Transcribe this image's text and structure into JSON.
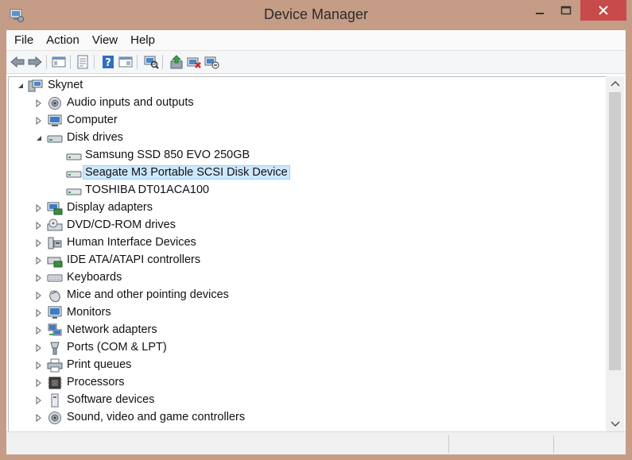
{
  "window": {
    "title": "Device Manager"
  },
  "menu": {
    "items": [
      "File",
      "Action",
      "View",
      "Help"
    ]
  },
  "toolbar": {
    "buttons": [
      "back-arrow-icon",
      "forward-arrow-icon",
      "show-hide-tree-icon",
      "properties-icon",
      "help-icon",
      "view-icon",
      "scan-hardware-icon",
      "update-driver-icon",
      "uninstall-icon",
      "disable-icon"
    ]
  },
  "tree": {
    "root": "Skynet",
    "categories": [
      {
        "label": "Audio inputs and outputs",
        "icon": "speaker-icon",
        "expanded": false
      },
      {
        "label": "Computer",
        "icon": "computer-icon",
        "expanded": false
      },
      {
        "label": "Disk drives",
        "icon": "disk-drive-icon",
        "expanded": true,
        "children": [
          "Samsung SSD 850 EVO 250GB",
          "Seagate M3 Portable SCSI Disk Device",
          "TOSHIBA DT01ACA100"
        ]
      },
      {
        "label": "Display adapters",
        "icon": "display-adapter-icon",
        "expanded": false
      },
      {
        "label": "DVD/CD-ROM drives",
        "icon": "dvd-drive-icon",
        "expanded": false
      },
      {
        "label": "Human Interface Devices",
        "icon": "hid-icon",
        "expanded": false
      },
      {
        "label": "IDE ATA/ATAPI controllers",
        "icon": "ide-controller-icon",
        "expanded": false
      },
      {
        "label": "Keyboards",
        "icon": "keyboard-icon",
        "expanded": false
      },
      {
        "label": "Mice and other pointing devices",
        "icon": "mouse-icon",
        "expanded": false
      },
      {
        "label": "Monitors",
        "icon": "monitor-icon",
        "expanded": false
      },
      {
        "label": "Network adapters",
        "icon": "network-adapter-icon",
        "expanded": false
      },
      {
        "label": "Ports (COM & LPT)",
        "icon": "port-icon",
        "expanded": false
      },
      {
        "label": "Print queues",
        "icon": "printer-icon",
        "expanded": false
      },
      {
        "label": "Processors",
        "icon": "processor-icon",
        "expanded": false
      },
      {
        "label": "Software devices",
        "icon": "software-device-icon",
        "expanded": false
      },
      {
        "label": "Sound, video and game controllers",
        "icon": "sound-controller-icon",
        "expanded": false
      }
    ],
    "selected_child": "Seagate M3 Portable SCSI Disk Device"
  },
  "colors": {
    "frame": "#c59c86",
    "close": "#c74b4b",
    "selection": "#cce8ff",
    "selection_border": "#99d1ff"
  }
}
